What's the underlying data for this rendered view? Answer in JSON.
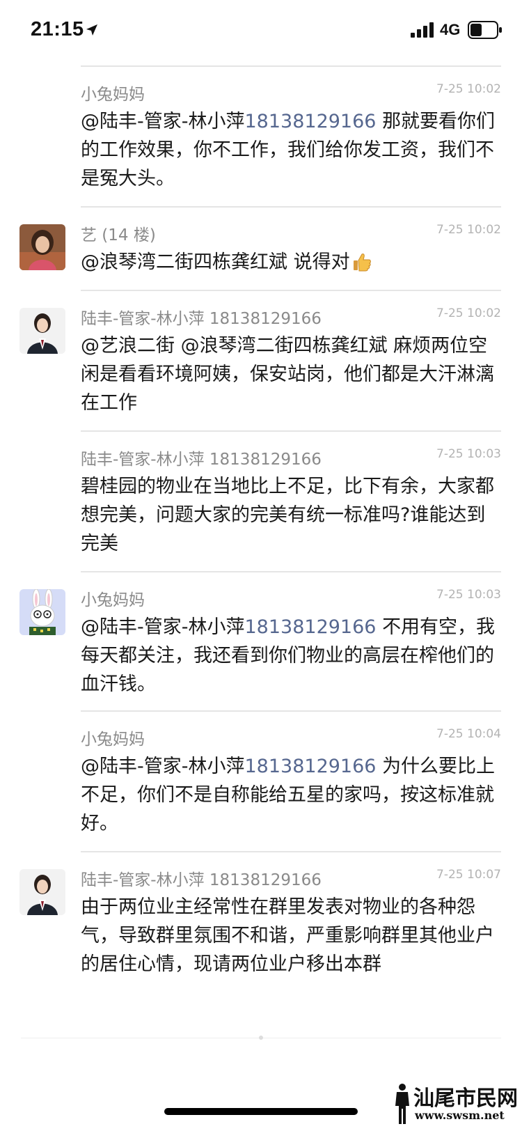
{
  "status_bar": {
    "time": "21:15",
    "network": "4G",
    "icons": [
      "location-arrow-icon",
      "signal-bars-icon",
      "battery-icon"
    ]
  },
  "messages": [
    {
      "author": "小兔妈妈",
      "time": "7-25 10:02",
      "avatar": "none",
      "mention": "@陆丰-管家-林小萍",
      "phone": "18138129166",
      "text": "那就要看你们的工作效果，你不工作，我们给你发工资，我们不是冤大头。"
    },
    {
      "author": "艺 (14 楼)",
      "time": "7-25 10:02",
      "avatar": "woman-photo-avatar",
      "text": "@浪琴湾二街四栋龚红斌 说得对",
      "emoji": "thumbs-up-icon"
    },
    {
      "author": "陆丰-管家-林小萍 18138129166",
      "time": "7-25 10:02",
      "avatar": "staff-uniform-avatar",
      "text": "@艺浪二街 @浪琴湾二街四栋龚红斌 麻烦两位空闲是看看环境阿姨，保安站岗，他们都是大汗淋漓在工作"
    },
    {
      "author": "陆丰-管家-林小萍 18138129166",
      "time": "7-25 10:03",
      "avatar": "none",
      "text": "碧桂园的物业在当地比上不足，比下有余，大家都想完美，问题大家的完美有统一标准吗?谁能达到完美"
    },
    {
      "author": "小兔妈妈",
      "time": "7-25 10:03",
      "avatar": "bunny-cartoon-avatar",
      "mention": "@陆丰-管家-林小萍",
      "phone": "18138129166",
      "text": "不用有空，我每天都关注，我还看到你们物业的高层在榨他们的血汗钱。"
    },
    {
      "author": "小兔妈妈",
      "time": "7-25 10:04",
      "avatar": "none",
      "mention": "@陆丰-管家-林小萍",
      "phone": "18138129166",
      "text": "为什么要比上不足，你们不是自称能给五星的家吗，按这标准就好。"
    },
    {
      "author": "陆丰-管家-林小萍 18138129166",
      "time": "7-25 10:07",
      "avatar": "staff-uniform-avatar",
      "text": "由于两位业主经常性在群里发表对物业的各种怨气，导致群里氛围不和谐，严重影响群里其他业户的居住心情，现请两位业户移出本群"
    }
  ],
  "watermark": {
    "title": "汕尾市民网",
    "url": "www.swsm.net"
  }
}
